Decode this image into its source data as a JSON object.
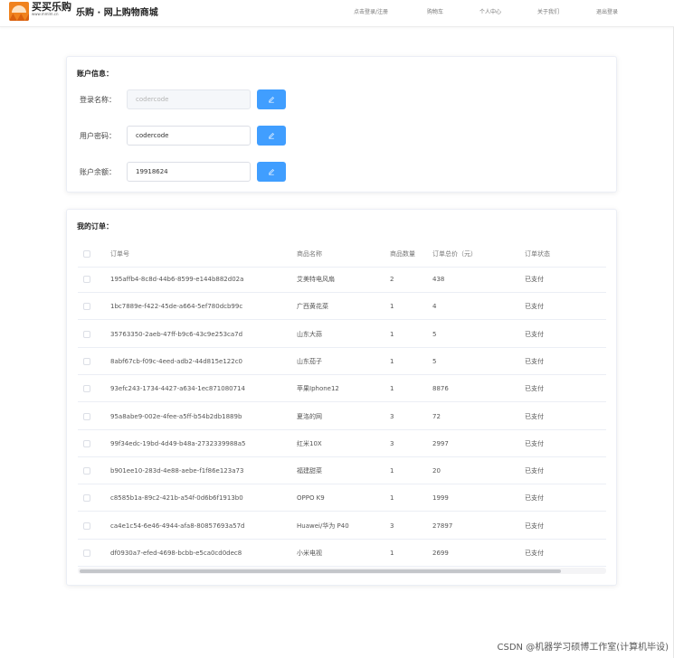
{
  "header": {
    "logo_text": "买买乐购",
    "logo_subtext": "www.mmlm.cn",
    "site_title": "乐购 · 网上购物商城",
    "nav": [
      {
        "label": "点击登录/注册"
      },
      {
        "label": "购物车"
      },
      {
        "label": "个人中心"
      },
      {
        "label": "关于我们"
      },
      {
        "label": "退出登录"
      }
    ]
  },
  "account": {
    "title": "账户信息：",
    "fields": [
      {
        "label": "登录名称：",
        "value": "codercode",
        "disabled": true
      },
      {
        "label": "用户密码：",
        "value": "codercode",
        "disabled": false
      },
      {
        "label": "账户余额：",
        "value": "19918624",
        "disabled": false
      }
    ],
    "edit_icon": "pencil-icon"
  },
  "orders": {
    "title": "我的订单：",
    "columns": [
      "订单号",
      "商品名称",
      "商品数量",
      "订单总价（元）",
      "订单状态"
    ],
    "rows": [
      {
        "id": "195affb4-8c8d-44b6-8599-e144b882d02a",
        "name": "艾美特电风扇",
        "qty": "2",
        "total": "438",
        "status": "已支付"
      },
      {
        "id": "1bc7889e-f422-45de-a664-5ef780dcb99c",
        "name": "广西黄花菜",
        "qty": "1",
        "total": "4",
        "status": "已支付"
      },
      {
        "id": "35763350-2aeb-47ff-b9c6-43c9e253ca7d",
        "name": "山东大蒜",
        "qty": "1",
        "total": "5",
        "status": "已支付"
      },
      {
        "id": "8abf67cb-f09c-4eed-adb2-44d815e122c0",
        "name": "山东茄子",
        "qty": "1",
        "total": "5",
        "status": "已支付"
      },
      {
        "id": "93efc243-1734-4427-a634-1ec871080714",
        "name": "苹果Iphone12",
        "qty": "1",
        "total": "8876",
        "status": "已支付"
      },
      {
        "id": "95a8abe9-002e-4fee-a5ff-b54b2db1889b",
        "name": "夏洛的网",
        "qty": "3",
        "total": "72",
        "status": "已支付"
      },
      {
        "id": "99f34edc-19bd-4d49-b48a-2732339988a5",
        "name": "红米10X",
        "qty": "3",
        "total": "2997",
        "status": "已支付"
      },
      {
        "id": "b901ee10-283d-4e88-aebe-f1f86e123a73",
        "name": "福建甜菜",
        "qty": "1",
        "total": "20",
        "status": "已支付"
      },
      {
        "id": "c8585b1a-89c2-421b-a54f-0d6b6f1913b0",
        "name": "OPPO K9",
        "qty": "1",
        "total": "1999",
        "status": "已支付"
      },
      {
        "id": "ca4e1c54-6e46-4944-afa8-80857693a57d",
        "name": "Huawei/华为 P40",
        "qty": "3",
        "total": "27897",
        "status": "已支付"
      },
      {
        "id": "df0930a7-efed-4698-bcbb-e5ca0cd0dec8",
        "name": "小米电视",
        "qty": "1",
        "total": "2699",
        "status": "已支付"
      }
    ]
  },
  "watermark": "CSDN @机器学习硕博工作室(计算机毕设)",
  "colors": {
    "primary": "#409eff",
    "logo_orange": "#f0821e"
  }
}
